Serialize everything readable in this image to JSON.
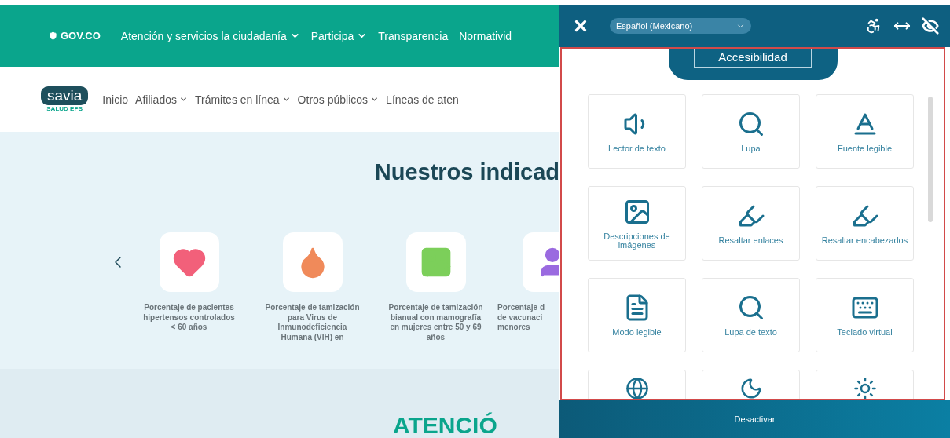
{
  "topbar": {
    "brand": "GOV.CO",
    "links": [
      {
        "label": "Atención y servicios la ciudadanía",
        "dropdown": true
      },
      {
        "label": "Participa",
        "dropdown": true
      },
      {
        "label": "Transparencia",
        "dropdown": false
      },
      {
        "label": "Normativid",
        "dropdown": false
      }
    ]
  },
  "site_nav": {
    "logo": "savia",
    "logo_sub": "SALUD EPS",
    "items": [
      {
        "label": "Inicio",
        "dropdown": false
      },
      {
        "label": "Afiliados",
        "dropdown": true
      },
      {
        "label": "Trámites en línea",
        "dropdown": true
      },
      {
        "label": "Otros públicos",
        "dropdown": true
      },
      {
        "label": "Líneas de aten",
        "dropdown": false
      }
    ]
  },
  "indicators": {
    "title": "Nuestros indicad",
    "items": [
      {
        "kind": "full",
        "color": "#f2607a",
        "lines": [
          "Porcentaje de pacientes",
          "hipertensos controlados",
          "< 60 años"
        ]
      },
      {
        "kind": "full",
        "color": "#f08a5a",
        "lines": [
          "Porcentaje de tamización",
          "para Virus de",
          "Inmunodeficiencia",
          "Humana (VIH) en"
        ]
      },
      {
        "kind": "full",
        "color": "#7ccf5a",
        "lines": [
          "Porcentaje de tamización",
          "bianual con mamografía",
          "en mujeres entre 50 y 69",
          "años"
        ]
      },
      {
        "kind": "partial",
        "color": "#9a6ae0",
        "lines": [
          "Porcentaje d",
          "de vacunaci",
          "menores"
        ]
      }
    ]
  },
  "next_section": {
    "title": "ATENCIÓ"
  },
  "accessibility_panel": {
    "language": "Español (Mexicano)",
    "tab": "Accesibilidad",
    "tools": [
      {
        "kind": "tool",
        "label": "Lector de texto"
      },
      {
        "kind": "tool",
        "label": "Lupa"
      },
      {
        "kind": "tool",
        "label": "Fuente legible"
      },
      {
        "kind": "tool",
        "label": "Descripciones de imágenes"
      },
      {
        "kind": "tool",
        "label": "Resaltar enlaces"
      },
      {
        "kind": "tool",
        "label": "Resaltar encabezados"
      },
      {
        "kind": "tool",
        "label": "Modo legible"
      },
      {
        "kind": "tool",
        "label": "Lupa de texto"
      },
      {
        "kind": "tool",
        "label": "Teclado virtual"
      },
      {
        "kind": "partial"
      },
      {
        "kind": "partial"
      },
      {
        "kind": "partial"
      }
    ],
    "footer_button": "Desactivar"
  }
}
